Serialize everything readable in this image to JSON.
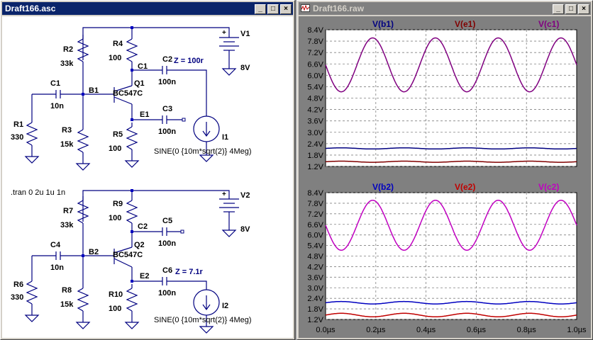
{
  "schematic": {
    "title": "Draft166.asc",
    "labels": {
      "r2": "R2",
      "r2v": "33k",
      "r4": "R4",
      "r4v": "100",
      "c1node": "C1",
      "c2": "C2",
      "z1": "Z = 100r",
      "c2v": "100n",
      "v1": "V1",
      "v1v": "8V",
      "c1": "C1",
      "c1v": "10n",
      "b1": "B1",
      "q1": "Q1",
      "q1m": "BC547C",
      "r1": "R1",
      "r1v": "330",
      "r3": "R3",
      "r3v": "15k",
      "e1": "E1",
      "c3": "C3",
      "c3v": "100n",
      "r5": "R5",
      "r5v": "100",
      "i1": "I1",
      "s1": "SINE(0 {10m*sqrt(2)} 4Meg)",
      "tran": ".tran 0 2u 1u 1n",
      "r7": "R7",
      "r7v": "33k",
      "r9": "R9",
      "r9v": "100",
      "c2node": "C2",
      "c5": "C5",
      "c5v": "100n",
      "v2": "V2",
      "v2v": "8V",
      "c4": "C4",
      "c4v": "10n",
      "b2": "B2",
      "q2": "Q2",
      "q2m": "BC547C",
      "r6": "R6",
      "r6v": "330",
      "r8": "R8",
      "r8v": "15k",
      "e2": "E2",
      "c6": "C6",
      "z2": "Z = 7.1r",
      "c6v": "100n",
      "r10": "R10",
      "r10v": "100",
      "i2": "I2",
      "s2": "SINE(0 {10m*sqrt(2)} 4Meg)"
    }
  },
  "waveform": {
    "title": "Draft166.raw",
    "xticks": [
      "0.0µs",
      "0.2µs",
      "0.4µs",
      "0.6µs",
      "0.8µs",
      "1.0µs"
    ],
    "panes": [
      {
        "yticks": [
          "8.4V",
          "7.8V",
          "7.2V",
          "6.6V",
          "6.0V",
          "5.4V",
          "4.8V",
          "4.2V",
          "3.6V",
          "3.0V",
          "2.4V",
          "1.8V",
          "1.2V"
        ],
        "legend": [
          {
            "label": "V(b1)",
            "color": "#000080"
          },
          {
            "label": "V(e1)",
            "color": "#800000"
          },
          {
            "label": "V(c1)",
            "color": "#800080"
          }
        ]
      },
      {
        "yticks": [
          "8.4V",
          "7.8V",
          "7.2V",
          "6.6V",
          "6.0V",
          "5.4V",
          "4.8V",
          "4.2V",
          "3.6V",
          "3.0V",
          "2.4V",
          "1.8V",
          "1.2V"
        ],
        "legend": [
          {
            "label": "V(b2)",
            "color": "#0000c0"
          },
          {
            "label": "V(e2)",
            "color": "#c00000"
          },
          {
            "label": "V(c2)",
            "color": "#c000c0"
          }
        ]
      }
    ]
  },
  "chart_data": [
    {
      "type": "line",
      "x_range": [
        0,
        1.0
      ],
      "ylim": [
        1.2,
        8.4
      ],
      "grid": true,
      "frequency_mhz": 4,
      "series": [
        {
          "name": "V(b1)",
          "dc": 2.15,
          "amplitude": 0.03,
          "phase": "in-phase"
        },
        {
          "name": "V(e1)",
          "dc": 1.45,
          "amplitude": 0.03,
          "phase": "in-phase"
        },
        {
          "name": "V(c1)",
          "dc": 6.55,
          "amplitude": 1.42,
          "phase": "inverted"
        }
      ]
    },
    {
      "type": "line",
      "x_range": [
        0,
        1.0
      ],
      "ylim": [
        1.2,
        8.4
      ],
      "grid": true,
      "frequency_mhz": 4,
      "series": [
        {
          "name": "V(b2)",
          "dc": 2.15,
          "amplitude": 0.07,
          "phase": "in-phase"
        },
        {
          "name": "V(e2)",
          "dc": 1.45,
          "amplitude": 0.1,
          "phase": "in-phase"
        },
        {
          "name": "V(c2)",
          "dc": 6.55,
          "amplitude": 1.42,
          "phase": "inverted"
        }
      ]
    }
  ]
}
